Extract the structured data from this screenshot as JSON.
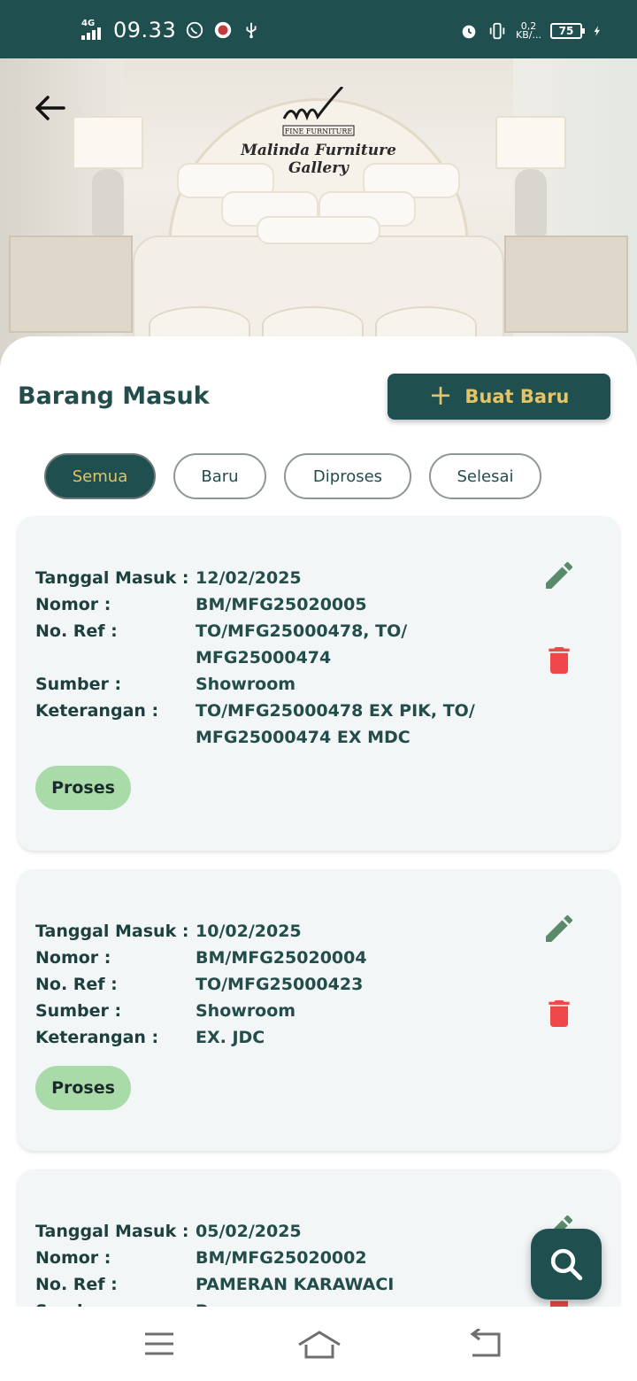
{
  "status_bar": {
    "network": "4G",
    "time": "09.33",
    "data_rate": "0,2",
    "data_unit": "KB/...",
    "battery": "75"
  },
  "header": {
    "logo_text": "Malinda Furniture Gallery",
    "logo_subtext": "FINE FURNITURE"
  },
  "page": {
    "title": "Barang Masuk",
    "new_button_label": "Buat Baru"
  },
  "filters": [
    {
      "label": "Semua",
      "active": true
    },
    {
      "label": "Baru",
      "active": false
    },
    {
      "label": "Diproses",
      "active": false
    },
    {
      "label": "Selesai",
      "active": false
    }
  ],
  "labels": {
    "tanggal": "Tanggal Masuk :",
    "nomor": "Nomor :",
    "no_ref": "No. Ref :",
    "sumber": "Sumber :",
    "keterangan": "Keterangan :"
  },
  "entries": [
    {
      "tanggal": "12/02/2025",
      "nomor": "BM/MFG25020005",
      "no_ref_1": "TO/MFG25000478, TO/",
      "no_ref_2": "MFG25000474",
      "sumber": "Showroom",
      "keterangan_1": "TO/MFG25000478 EX PIK, TO/",
      "keterangan_2": "MFG25000474 EX MDC",
      "status": "Proses"
    },
    {
      "tanggal": "10/02/2025",
      "nomor": "BM/MFG25020004",
      "no_ref_1": "TO/MFG25000423",
      "sumber": "Showroom",
      "keterangan_1": "EX. JDC",
      "status": "Proses"
    },
    {
      "tanggal": "05/02/2025",
      "nomor": "BM/MFG25020002",
      "no_ref_1": "PAMERAN KARAWACI",
      "sumber": "P"
    }
  ],
  "colors": {
    "primary": "#1f4f4e",
    "accent": "#e3c466",
    "edit_icon": "#5b8a6b",
    "delete_icon": "#f04848",
    "status_pill": "#a9dba9"
  },
  "icons": {
    "back": "arrow-left-icon",
    "new": "plus-icon",
    "edit": "pencil-icon",
    "delete": "trash-icon",
    "search": "search-icon"
  }
}
